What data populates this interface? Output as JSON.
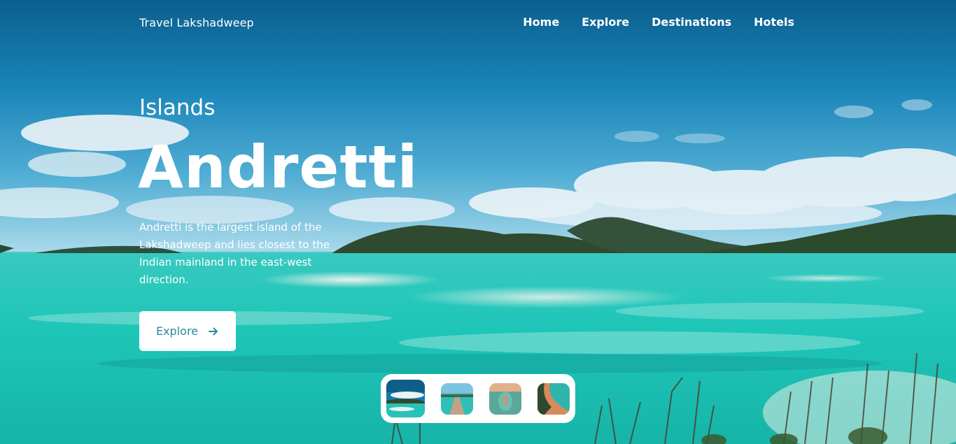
{
  "brand": "Travel Lakshadweep",
  "nav": {
    "items": [
      {
        "label": "Home"
      },
      {
        "label": "Explore"
      },
      {
        "label": "Destinations"
      },
      {
        "label": "Hotels"
      }
    ]
  },
  "hero": {
    "subtitle": "Islands",
    "title": "Andretti",
    "description": "Andretti is the largest island of the Lakshadweep and lies closest to the Indian mainland in the east-west direction.",
    "button_label": "Explore"
  },
  "icons": {
    "button_icon": "arrow-right-icon"
  },
  "colors": {
    "accent": "#2a8a9c",
    "white": "#ffffff"
  }
}
